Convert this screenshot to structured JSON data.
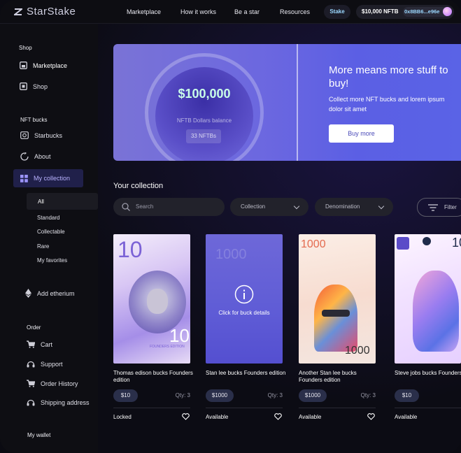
{
  "header": {
    "logo_text": "StarStake",
    "nav": [
      "Marketplace",
      "How it works",
      "Be a star",
      "Resources"
    ],
    "stake_label": "Stake",
    "wallet_balance": "$10,000 NFTB",
    "wallet_address": "0x8BB6...e96e"
  },
  "sidebar": {
    "shop_title": "Shop",
    "shop_items": [
      "Marketplace",
      "Shop"
    ],
    "nft_title": "NFT bucks",
    "nft_items": [
      "Starbucks",
      "About",
      "My collection"
    ],
    "sub_items": [
      "All",
      "Standard",
      "Collectable",
      "Rare",
      "My favorites"
    ],
    "add_item": "Add etherium",
    "order_title": "Order",
    "order_items": [
      "Cart",
      "Support",
      "Order History",
      "Shipping address"
    ],
    "wallet_title": "My wallet"
  },
  "banner": {
    "balance": "$100,000",
    "balance_label": "NFTB Dollars balance",
    "balance_chip": "33 NFTBs",
    "promo_title": "More means more stuff to buy!",
    "promo_sub": "Collect more NFT bucks and lorem ipsum dolor sit amet",
    "buy_label": "Buy more"
  },
  "collection": {
    "title": "Your collection",
    "search_placeholder": "Search",
    "dropdown_collection": "Collection",
    "dropdown_denomination": "Denomination",
    "filter_label": "Filter",
    "overlay_text": "Click for buck details",
    "cards": [
      {
        "title": "Thomas edison bucks Founders edition",
        "price": "$10",
        "qty": "Qty: 3",
        "status": "Locked",
        "note_value": "10",
        "note_edition": "FOUNDERS EDITION"
      },
      {
        "title": "Stan lee bucks Founders edition",
        "price": "$1000",
        "qty": "Qty: 3",
        "status": "Available",
        "note_value": "1000"
      },
      {
        "title": "Another Stan lee bucks Founders edition",
        "price": "$1000",
        "qty": "Qty: 3",
        "status": "Available",
        "note_value": "1000"
      },
      {
        "title": "Steve jobs bucks Founders edition",
        "price": "$10",
        "qty": "",
        "status": "Available",
        "note_value": "10"
      }
    ]
  },
  "colors": {
    "accent": "#6b67e0",
    "active_bg": "#20204a",
    "balance": "#c9ffe8"
  }
}
